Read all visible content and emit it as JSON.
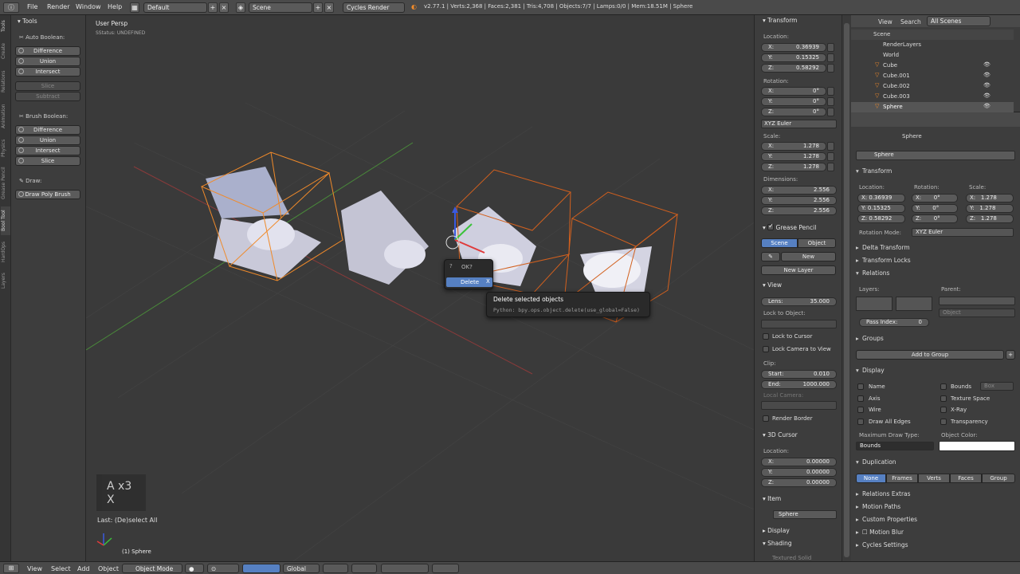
{
  "topbar": {
    "menus": [
      "File",
      "Render",
      "Window",
      "Help"
    ],
    "layout": "Default",
    "scene": "Scene",
    "engine": "Cycles Render",
    "stats": "v2.77.1 | Verts:2,368 | Faces:2,381 | Tris:4,708 | Objects:7/7 | Lamps:0/0 | Mem:18.51M | Sphere"
  },
  "toolshelf": {
    "tools_header": "Tools",
    "auto_boolean": "Auto Boolean:",
    "auto_buttons": [
      "Difference",
      "Union",
      "Intersect"
    ],
    "dim_buttons": [
      "Slice",
      "Subtract"
    ],
    "brush_boolean": "Brush Boolean:",
    "brush_buttons": [
      "Difference",
      "Union",
      "Intersect",
      "Slice"
    ],
    "draw_label": "Draw:",
    "draw_poly": "Draw Poly Brush",
    "tabs": [
      "Tools",
      "Create",
      "Relations",
      "Animation",
      "Physics",
      "Grease Pencil",
      "Bool Tool",
      "HardOps",
      "Layers"
    ]
  },
  "viewport": {
    "view_name": "User Persp",
    "status": "SStatus: UNDEFINED",
    "key_display_line1": "A x3",
    "key_display_line2": "X",
    "last_op": "Last: (De)select All",
    "object_label": "(1) Sphere"
  },
  "popup": {
    "title": "OK?",
    "item": "Delete",
    "tooltip_title": "Delete selected objects",
    "tooltip_python": "Python: bpy.ops.object.delete(use_global=False)"
  },
  "npanel": {
    "transform": "Transform",
    "location": "Location:",
    "loc": [
      {
        "a": "X:",
        "v": "0.36939"
      },
      {
        "a": "Y:",
        "v": "0.15325"
      },
      {
        "a": "Z:",
        "v": "0.58292"
      }
    ],
    "rotation": "Rotation:",
    "rot": [
      {
        "a": "X:",
        "v": "0°"
      },
      {
        "a": "Y:",
        "v": "0°"
      },
      {
        "a": "Z:",
        "v": "0°"
      }
    ],
    "rotmode": "XYZ Euler",
    "scale": "Scale:",
    "scl": [
      {
        "a": "X:",
        "v": "1.278"
      },
      {
        "a": "Y:",
        "v": "1.278"
      },
      {
        "a": "Z:",
        "v": "1.278"
      }
    ],
    "dimensions": "Dimensions:",
    "dim": [
      {
        "a": "X:",
        "v": "2.556"
      },
      {
        "a": "Y:",
        "v": "2.556"
      },
      {
        "a": "Z:",
        "v": "2.556"
      }
    ],
    "grease": "Grease Pencil",
    "gp_scene": "Scene",
    "gp_object": "Object",
    "gp_new": "New",
    "gp_newlayer": "New Layer",
    "view": "View",
    "lens_label": "Lens:",
    "lens_value": "35.000",
    "lock_obj": "Lock to Object:",
    "lock_cursor": "Lock to Cursor",
    "lock_cam": "Lock Camera to View",
    "clip": "Clip:",
    "clip_start_label": "Start:",
    "clip_start": "0.010",
    "clip_end_label": "End:",
    "clip_end": "1000.000",
    "local_cam": "Local Camera:",
    "render_border": "Render Border",
    "cursor": "3D Cursor",
    "cur_loc": "Location:",
    "cur": [
      {
        "a": "X:",
        "v": "0.00000"
      },
      {
        "a": "Y:",
        "v": "0.00000"
      },
      {
        "a": "Z:",
        "v": "0.00000"
      }
    ],
    "item": "Item",
    "item_name": "Sphere",
    "display": "Display",
    "shading": "Shading",
    "textured": "Textured Solid"
  },
  "outliner": {
    "menus": [
      "View",
      "Search"
    ],
    "scenes": "All Scenes",
    "rows": [
      "Scene",
      "RenderLayers",
      "World",
      "Cube",
      "Cube.001",
      "Cube.002",
      "Cube.003",
      "Sphere"
    ]
  },
  "props": {
    "breadcrumb": "Sphere",
    "name": "Sphere",
    "transform": "Transform",
    "location": "Location:",
    "rotation": "Rotation:",
    "scale": "Scale:",
    "loc": [
      "X: 0.36939",
      "Y: 0.15325",
      "Z: 0.58292"
    ],
    "rot": [
      "X:       0°",
      "Y:       0°",
      "Z:       0°"
    ],
    "scl": [
      "X:   1.278",
      "Y:   1.278",
      "Z:   1.278"
    ],
    "rotmode_label": "Rotation Mode:",
    "rotmode": "XYZ Euler",
    "delta": "Delta Transform",
    "locks": "Transform Locks",
    "relations": "Relations",
    "layers": "Layers:",
    "parent": "Parent:",
    "parent_type": "Object",
    "pass_label": "Pass Index:",
    "pass_value": "0",
    "groups": "Groups",
    "add_group": "Add to Group",
    "display": "Display",
    "disp_left": [
      "Name",
      "Axis",
      "Wire",
      "Draw All Edges"
    ],
    "disp_right": [
      "Bounds",
      "Texture Space",
      "X-Ray",
      "Transparency"
    ],
    "bounds_type": "Box",
    "max_draw": "Maximum Draw Type:",
    "max_draw_value": "Bounds",
    "obj_color": "Object Color:",
    "duplication": "Duplication",
    "dup_buttons": [
      "None",
      "Frames",
      "Verts",
      "Faces",
      "Group"
    ],
    "rel_extras": "Relations Extras",
    "motion_paths": "Motion Paths",
    "custom_props": "Custom Properties",
    "motion_blur": "Motion Blur",
    "cycles": "Cycles Settings"
  },
  "bottombar": {
    "menus": [
      "View",
      "Select",
      "Add",
      "Object"
    ],
    "mode": "Object Mode",
    "orientation": "Global"
  },
  "colors": {
    "accent": "#5680c2",
    "selection_orange": "#f08a2a",
    "wire_orange": "#d2601e"
  }
}
